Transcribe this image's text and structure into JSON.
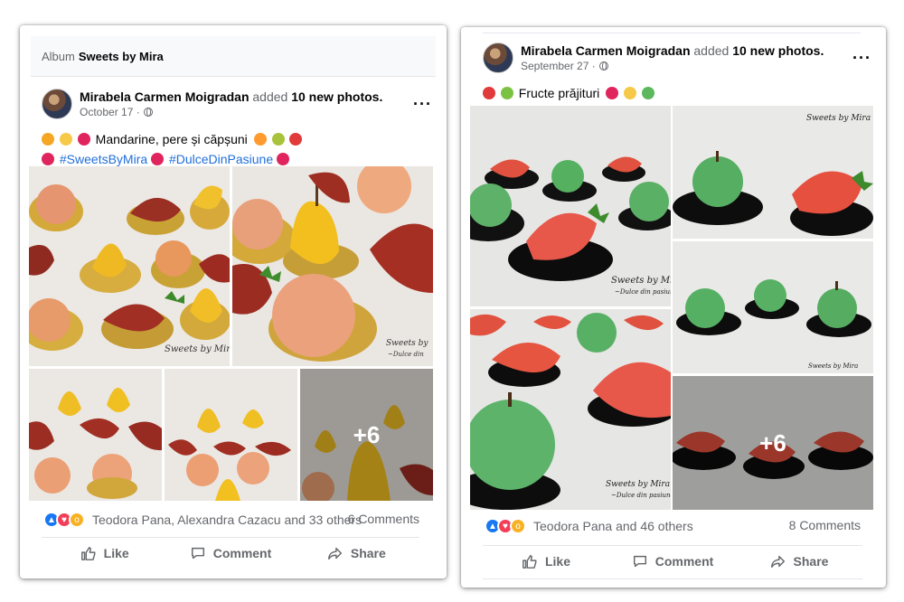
{
  "left_post": {
    "album_prefix": "Album",
    "album_name": "Sweets by Mira",
    "author": "Mirabela Carmen Moigradan",
    "action_text": "added",
    "count_text": "10 new photos.",
    "date": "October 17 ·",
    "text_line1": "Mandarine, pere și căpșuni",
    "hashtag1": "#SweetsByMira",
    "hashtag2": "#DulceDinPasiune",
    "more_count": "+6",
    "reactions_text": "Teodora Pana, Alexandra Cazacu and 33 others",
    "comments": "6 Comments",
    "like_label": "Like",
    "comment_label": "Comment",
    "share_label": "Share",
    "watermark": "Sweets by Mira"
  },
  "right_post": {
    "author": "Mirabela Carmen Moigradan",
    "action_text": "added",
    "count_text": "10 new photos.",
    "date": "September 27 ·",
    "text_line1": "Fructe prăjituri",
    "more_count": "+6",
    "reactions_text": "Teodora Pana and 46 others",
    "comments": "8 Comments",
    "like_label": "Like",
    "comment_label": "Comment",
    "share_label": "Share",
    "watermark": "Sweets by Mira"
  },
  "colors": {
    "link_blue": "#216fdb",
    "secondary_text": "#65676b",
    "like_blue": "#1877f2",
    "love_red": "#f33e58",
    "wow_yellow": "#f7b125"
  }
}
